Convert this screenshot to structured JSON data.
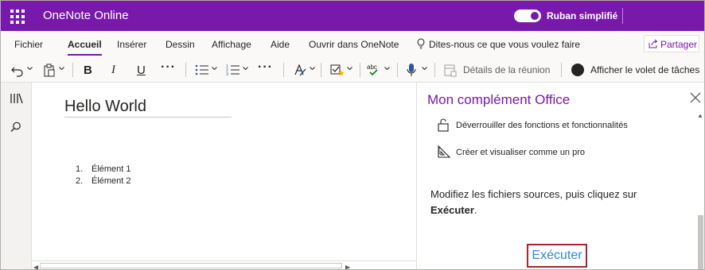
{
  "titlebar": {
    "app_title": "OneNote Online",
    "toggle_label": "Ruban simplifié",
    "brand_color": "#7719aa"
  },
  "menu": {
    "tabs": [
      "Fichier",
      "Accueil",
      "Insérer",
      "Dessin",
      "Affichage",
      "Aide",
      "Ouvrir dans OneNote"
    ],
    "active_tab": "Accueil",
    "tell_me": "Dites-nous ce que vous voulez faire",
    "share_label": "Partager"
  },
  "toolbar": {
    "bold": "B",
    "italic": "I",
    "underline": "U",
    "more": "···",
    "spelling_label": "abc",
    "meeting_details": "Détails de la réunion",
    "show_taskpane": "Afficher le volet de tâches"
  },
  "page": {
    "title": "Hello World",
    "list_items": [
      {
        "num": "1.",
        "text": "Élément 1"
      },
      {
        "num": "2.",
        "text": "Élément 2"
      }
    ]
  },
  "taskpane": {
    "title": "Mon complément Office",
    "features": [
      {
        "icon": "unlock-icon",
        "text": "Déverrouiller des fonctions et fonctionnalités"
      },
      {
        "icon": "design-icon",
        "text": "Créer et visualiser comme un pro"
      }
    ],
    "description_prefix": "Modifiez les fichiers sources, puis cliquez sur",
    "description_bold": "Exécuter",
    "description_suffix": ".",
    "run_button": "Exécuter",
    "run_color": "#2b88d8",
    "highlight_color": "#a4262c"
  }
}
